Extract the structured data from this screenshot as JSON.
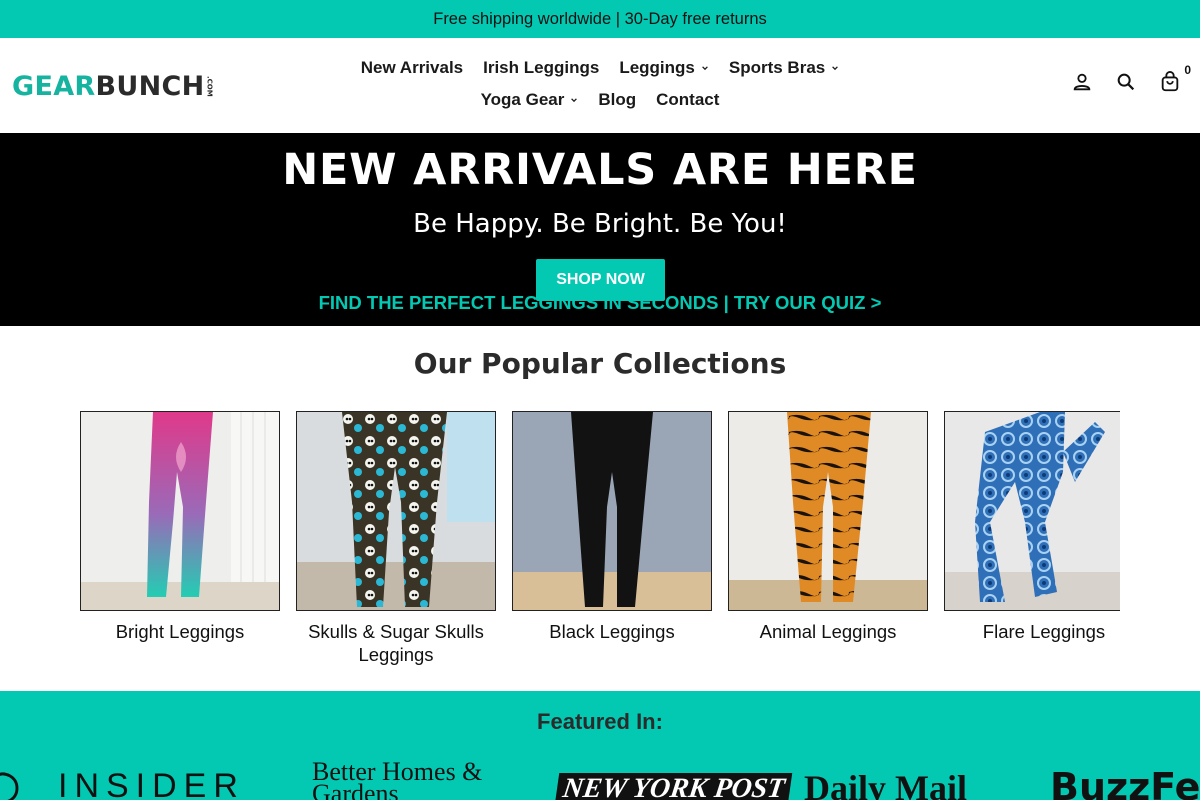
{
  "announcement": "Free shipping worldwide | 30-Day free returns",
  "logo": {
    "part1": "GEAR",
    "part2": "BUNCH",
    "suffix": ".COM"
  },
  "nav": {
    "row1": [
      {
        "label": "New Arrivals",
        "dropdown": false
      },
      {
        "label": "Irish Leggings",
        "dropdown": false
      },
      {
        "label": "Leggings",
        "dropdown": true
      },
      {
        "label": "Sports Bras",
        "dropdown": true
      }
    ],
    "row2": [
      {
        "label": "Yoga Gear",
        "dropdown": true
      },
      {
        "label": "Blog",
        "dropdown": false
      },
      {
        "label": "Contact",
        "dropdown": false
      }
    ]
  },
  "header_icons": {
    "account": "account-icon",
    "search": "search-icon",
    "cart": "cart-icon",
    "cart_count": "0"
  },
  "hero": {
    "title": "NEW ARRIVALS ARE HERE",
    "subtitle": "Be Happy. Be Bright. Be You!",
    "button": "SHOP NOW",
    "quiz_link": "FIND THE PERFECT LEGGINGS IN SECONDS | TRY OUR QUIZ >"
  },
  "collections": {
    "title": "Our Popular Collections",
    "items": [
      {
        "label": "Bright Leggings"
      },
      {
        "label": "Skulls & Sugar Skulls Leggings"
      },
      {
        "label": "Black Leggings"
      },
      {
        "label": "Animal Leggings"
      },
      {
        "label": "Flare Leggings"
      }
    ]
  },
  "featured": {
    "title": "Featured In:",
    "logos": [
      "INSIDER",
      "Better Homes & Gardens",
      "NEW YORK POST",
      "Daily Mail",
      "BuzzFeed"
    ]
  },
  "colors": {
    "accent": "#03c9b3",
    "logo_teal": "#17b3a1",
    "hero_bg": "#000000"
  }
}
